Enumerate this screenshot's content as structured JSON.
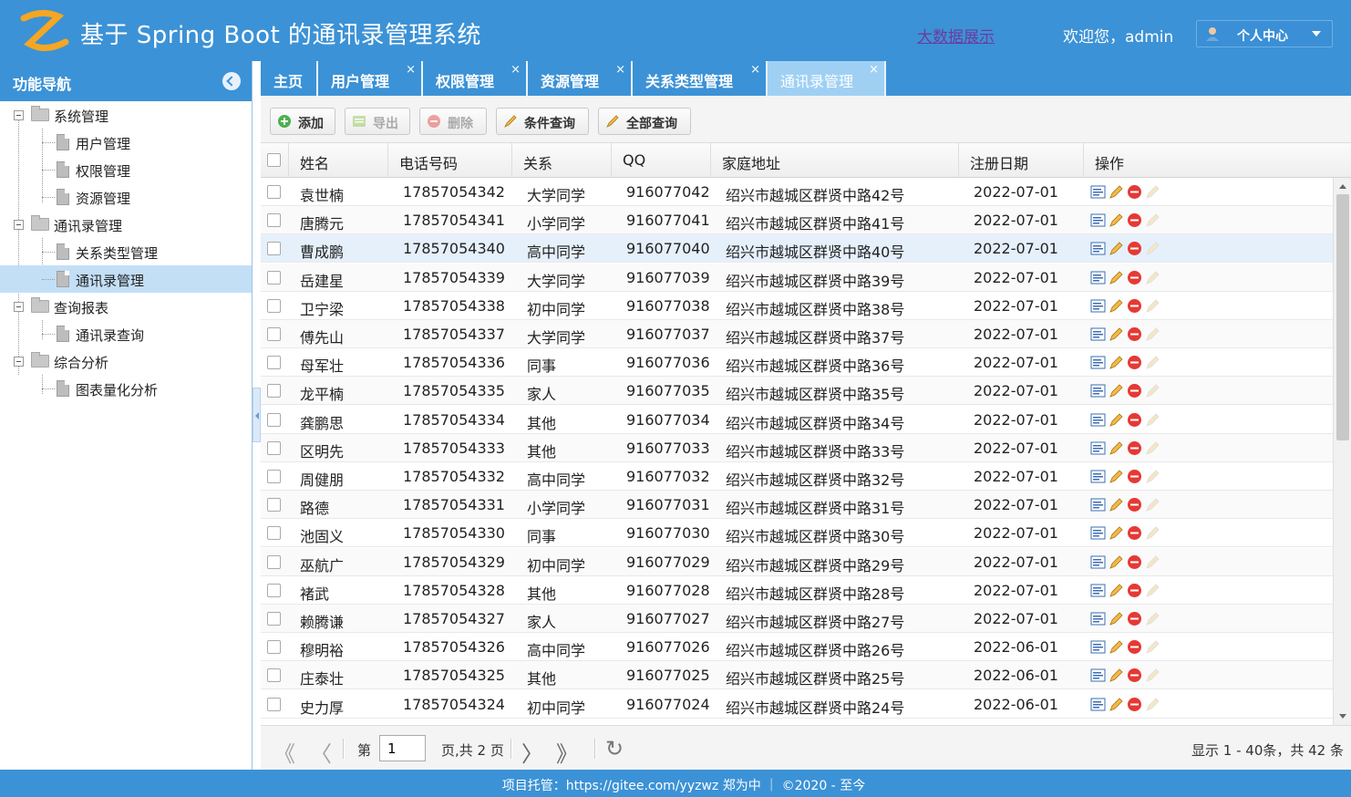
{
  "header": {
    "title": "基于 Spring Boot 的通讯录管理系统",
    "big_data_link": "大数据展示",
    "welcome": "欢迎您，admin",
    "user_menu_label": "个人中心"
  },
  "sidebar": {
    "title": "功能导航",
    "tree": [
      {
        "label": "系统管理",
        "type": "folder"
      },
      {
        "label": "用户管理",
        "type": "leaf"
      },
      {
        "label": "权限管理",
        "type": "leaf"
      },
      {
        "label": "资源管理",
        "type": "leaf"
      },
      {
        "label": "通讯录管理",
        "type": "folder"
      },
      {
        "label": "关系类型管理",
        "type": "leaf"
      },
      {
        "label": "通讯录管理",
        "type": "leaf",
        "selected": true
      },
      {
        "label": "查询报表",
        "type": "folder"
      },
      {
        "label": "通讯录查询",
        "type": "leaf"
      },
      {
        "label": "综合分析",
        "type": "folder"
      },
      {
        "label": "图表量化分析",
        "type": "leaf"
      }
    ]
  },
  "tabs": [
    {
      "label": "主页",
      "closable": false
    },
    {
      "label": "用户管理",
      "closable": true
    },
    {
      "label": "权限管理",
      "closable": true
    },
    {
      "label": "资源管理",
      "closable": true
    },
    {
      "label": "关系类型管理",
      "closable": true
    },
    {
      "label": "通讯录管理",
      "closable": true,
      "active": true
    }
  ],
  "tab_close_glyph": "×",
  "toolbar": {
    "add": "添加",
    "export": "导出",
    "delete": "删除",
    "conditional_query": "条件查询",
    "all_query": "全部查询"
  },
  "grid": {
    "columns": [
      "姓名",
      "电话号码",
      "关系",
      "QQ",
      "家庭地址",
      "注册日期",
      "操作"
    ],
    "rows": [
      [
        "袁世楠",
        "17857054342",
        "大学同学",
        "916077042",
        "绍兴市越城区群贤中路42号",
        "2022-07-01"
      ],
      [
        "唐腾元",
        "17857054341",
        "小学同学",
        "916077041",
        "绍兴市越城区群贤中路41号",
        "2022-07-01"
      ],
      [
        "曹成鹏",
        "17857054340",
        "高中同学",
        "916077040",
        "绍兴市越城区群贤中路40号",
        "2022-07-01"
      ],
      [
        "岳建星",
        "17857054339",
        "大学同学",
        "916077039",
        "绍兴市越城区群贤中路39号",
        "2022-07-01"
      ],
      [
        "卫宁梁",
        "17857054338",
        "初中同学",
        "916077038",
        "绍兴市越城区群贤中路38号",
        "2022-07-01"
      ],
      [
        "傅先山",
        "17857054337",
        "大学同学",
        "916077037",
        "绍兴市越城区群贤中路37号",
        "2022-07-01"
      ],
      [
        "母军壮",
        "17857054336",
        "同事",
        "916077036",
        "绍兴市越城区群贤中路36号",
        "2022-07-01"
      ],
      [
        "龙平楠",
        "17857054335",
        "家人",
        "916077035",
        "绍兴市越城区群贤中路35号",
        "2022-07-01"
      ],
      [
        "龚鹏思",
        "17857054334",
        "其他",
        "916077034",
        "绍兴市越城区群贤中路34号",
        "2022-07-01"
      ],
      [
        "区明先",
        "17857054333",
        "其他",
        "916077033",
        "绍兴市越城区群贤中路33号",
        "2022-07-01"
      ],
      [
        "周健朋",
        "17857054332",
        "高中同学",
        "916077032",
        "绍兴市越城区群贤中路32号",
        "2022-07-01"
      ],
      [
        "路德",
        "17857054331",
        "小学同学",
        "916077031",
        "绍兴市越城区群贤中路31号",
        "2022-07-01"
      ],
      [
        "池固义",
        "17857054330",
        "同事",
        "916077030",
        "绍兴市越城区群贤中路30号",
        "2022-07-01"
      ],
      [
        "巫航广",
        "17857054329",
        "初中同学",
        "916077029",
        "绍兴市越城区群贤中路29号",
        "2022-07-01"
      ],
      [
        "褚武",
        "17857054328",
        "其他",
        "916077028",
        "绍兴市越城区群贤中路28号",
        "2022-07-01"
      ],
      [
        "赖腾谦",
        "17857054327",
        "家人",
        "916077027",
        "绍兴市越城区群贤中路27号",
        "2022-07-01"
      ],
      [
        "穆明裕",
        "17857054326",
        "高中同学",
        "916077026",
        "绍兴市越城区群贤中路26号",
        "2022-06-01"
      ],
      [
        "庄泰壮",
        "17857054325",
        "其他",
        "916077025",
        "绍兴市越城区群贤中路25号",
        "2022-06-01"
      ],
      [
        "史力厚",
        "17857054324",
        "初中同学",
        "916077024",
        "绍兴市越城区群贤中路24号",
        "2022-06-01"
      ]
    ]
  },
  "pager": {
    "page_prefix": "第",
    "page_value": "1",
    "page_suffix": "页,共 2 页",
    "info": "显示 1 - 40条，共 42 条",
    "first_glyph": "《",
    "prev_glyph": "〈",
    "next_glyph": "〉",
    "last_glyph": "》",
    "refresh_glyph": "↻"
  },
  "footer": {
    "text": "项目托管：https://gitee.com/yyzwz 郑为中 ｜ ©2020 - 至今"
  },
  "colors": {
    "primary": "#3c92d6",
    "active_tab": "#9fd0f4",
    "selected_tree": "#c3dff6",
    "row_hover": "#e5f0fb"
  }
}
